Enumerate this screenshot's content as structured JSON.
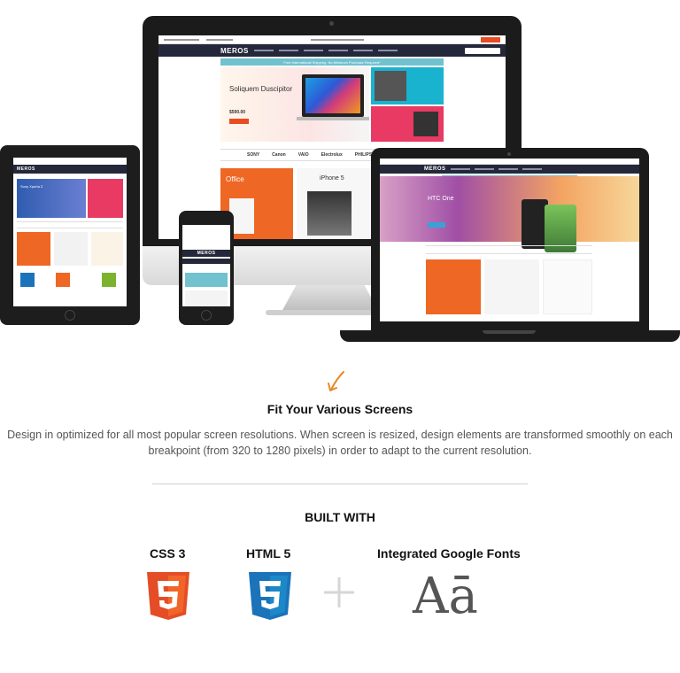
{
  "hero": {
    "imac_site": {
      "logo": "MEROS",
      "shipping_banner": "Free International Shipping. No Minimum Purchase Required*",
      "slider_title": "Soliquem Duscipitor",
      "slider_price": "$590.00",
      "brands": [
        "SONY",
        "Canon",
        "VAIO",
        "Electrolux",
        "PHILIPS"
      ],
      "promo_left": "Office",
      "promo_right": "iPhone 5"
    },
    "ipad_site": {
      "logo": "MEROS",
      "banner_title": "Sony Xperia Z"
    },
    "iphone_site": {
      "logo": "MEROS"
    },
    "macbook_site": {
      "logo": "MEROS",
      "hero_title": "HTC One"
    }
  },
  "features": {
    "title": "Fit Your Various Screens",
    "description": "Design in optimized for all most popular screen resolutions. When screen is resized, design elements are transformed smoothly on each breakpoint (from 320 to 1280 pixels) in order to adapt to the current resolution."
  },
  "built_with": {
    "title": "BUILT WITH",
    "items": [
      {
        "label": "CSS 3",
        "icon": "html5-shield-icon"
      },
      {
        "label": "HTML 5",
        "icon": "css3-shield-icon"
      },
      {
        "label": "Integrated Google Fonts",
        "icon": "font-sample-icon",
        "sample": "Aā"
      }
    ]
  },
  "colors": {
    "accent": "#e74c23",
    "html5_orange": "#e44d26",
    "css3_blue": "#1b73ba",
    "nav_dark": "#25283a",
    "teal": "#71c1cf"
  }
}
